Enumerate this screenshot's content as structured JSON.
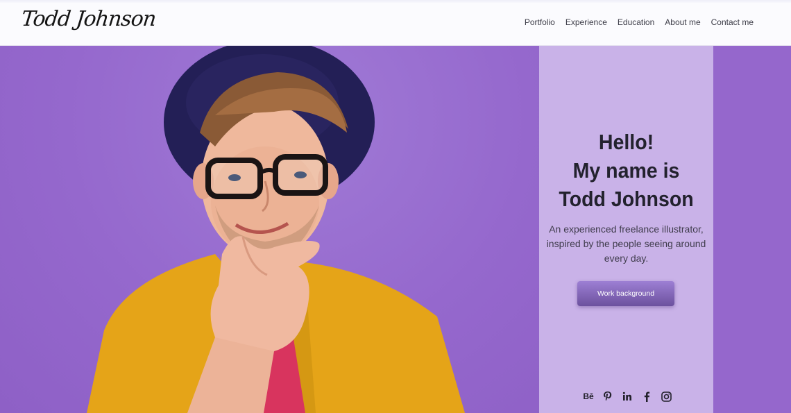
{
  "header": {
    "logo_text": "Todd Johnson",
    "nav": [
      {
        "label": "Portfolio"
      },
      {
        "label": "Experience"
      },
      {
        "label": "Education"
      },
      {
        "label": "About me"
      },
      {
        "label": "Contact me"
      }
    ]
  },
  "hero": {
    "greeting_lines": [
      "Hello!",
      "My name is",
      "Todd Johnson"
    ],
    "intro": "An experienced freelance illustrator, inspired by the people seeing around every day.",
    "cta_label": "Work background",
    "socials": [
      {
        "icon": "behance-icon",
        "glyph": "Bē"
      },
      {
        "icon": "pinterest-icon"
      },
      {
        "icon": "linkedin-icon"
      },
      {
        "icon": "facebook-icon"
      },
      {
        "icon": "instagram-icon"
      }
    ]
  },
  "colors": {
    "hero_bg": "#9567cc",
    "panel_bg": "#c9b2e8",
    "button": "#7c5fb4",
    "hat": "#231f56",
    "shirt": "#e5a418",
    "tshirt": "#d8345e"
  }
}
